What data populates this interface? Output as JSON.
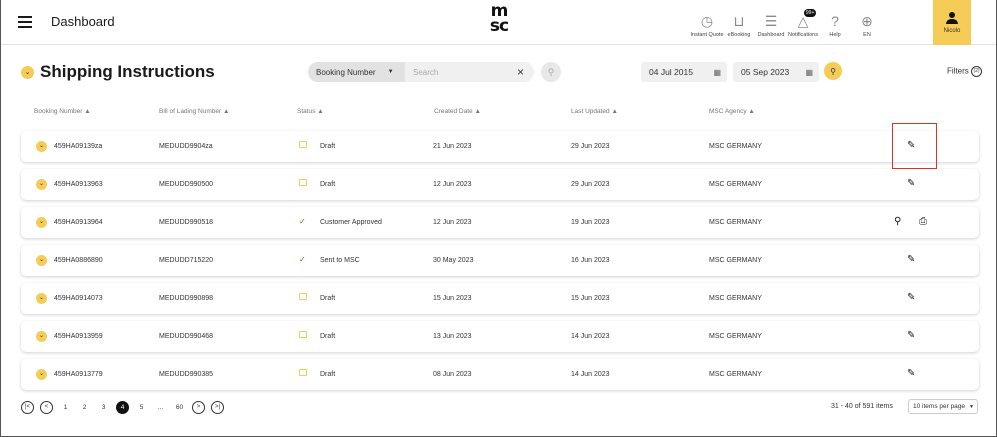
{
  "header": {
    "title": "Dashboard",
    "nav": [
      {
        "label": "Instant Quote",
        "icon": "stopwatch-icon"
      },
      {
        "label": "eBooking",
        "icon": "cart-icon"
      },
      {
        "label": "Dashboard",
        "icon": "sliders-icon"
      },
      {
        "label": "Notifications",
        "icon": "bell-icon",
        "badge": "99+"
      },
      {
        "label": "Help",
        "icon": "help-icon"
      },
      {
        "label": "EN",
        "icon": "globe-icon"
      }
    ],
    "user": "Nicolo"
  },
  "page": {
    "title": "Shipping Instructions",
    "search_type": "Booking Number",
    "search_placeholder": "Search",
    "date_from": "04 Jul 2015",
    "date_to": "05 Sep 2023",
    "filters_label": "Filters",
    "filters_count": "(2)"
  },
  "table": {
    "columns": [
      "Booking Number",
      "Bill of Lading Number",
      "Status",
      "Created Date",
      "Last Updated",
      "MSC Agency"
    ],
    "rows": [
      {
        "booking": "459HA09139za",
        "bol": "MEDUDD9904za",
        "status": "Draft",
        "created": "21 Jun 2023",
        "updated": "29 Jun 2023",
        "agency": "MSC GERMANY",
        "actions": "edit"
      },
      {
        "booking": "459HA0913963",
        "bol": "MEDUDD990500",
        "status": "Draft",
        "created": "12 Jun 2023",
        "updated": "29 Jun 2023",
        "agency": "MSC GERMANY",
        "actions": "edit"
      },
      {
        "booking": "459HA0913964",
        "bol": "MEDUDD990518",
        "status": "Customer Approved",
        "created": "12 Jun 2023",
        "updated": "19 Jun 2023",
        "agency": "MSC GERMANY",
        "actions": "view-print"
      },
      {
        "booking": "459HA0886890",
        "bol": "MEDUDD715220",
        "status": "Sent to MSC",
        "created": "30 May 2023",
        "updated": "16 Jun 2023",
        "agency": "MSC GERMANY",
        "actions": "edit"
      },
      {
        "booking": "459HA0914073",
        "bol": "MEDUDD990898",
        "status": "Draft",
        "created": "15 Jun 2023",
        "updated": "15 Jun 2023",
        "agency": "MSC GERMANY",
        "actions": "edit"
      },
      {
        "booking": "459HA0913959",
        "bol": "MEDUDD990468",
        "status": "Draft",
        "created": "13 Jun 2023",
        "updated": "14 Jun 2023",
        "agency": "MSC GERMANY",
        "actions": "edit"
      },
      {
        "booking": "459HA0913779",
        "bol": "MEDUDD990385",
        "status": "Draft",
        "created": "08 Jun 2023",
        "updated": "14 Jun 2023",
        "agency": "MSC GERMANY",
        "actions": "edit"
      }
    ]
  },
  "pagination": {
    "pages": [
      "1",
      "2",
      "3",
      "4",
      "5",
      "...",
      "60"
    ],
    "current": "4",
    "range": "31 - 40 of 591 items",
    "per_page": "10 items per page"
  }
}
